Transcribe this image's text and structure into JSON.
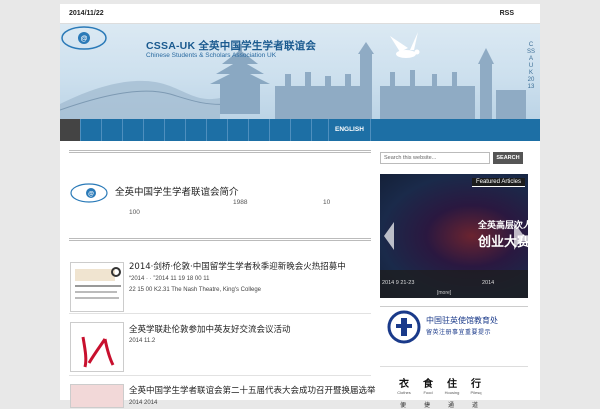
{
  "topbar": {
    "date": "2014/11/22",
    "rss": "RSS"
  },
  "header": {
    "logo_text": "css@uk",
    "title": "CSSA-UK 全英中国学生学者联谊会",
    "subtitle": "Chinese Students & Scholars Association UK",
    "vertical_text": "CSSAUK 2013"
  },
  "nav": {
    "english_label": "ENGLISH"
  },
  "intro": {
    "title": "全英中国学生学者联谊会简介",
    "year": "1988",
    "num1": "10",
    "num2": "100"
  },
  "posts": [
    {
      "title": "2014·剑桥·伦敦·中国留学生学者秋季迎新晚会火热招募中",
      "meta_line1": "“2014      ·      ·      ”2014  11 19 18 00      11",
      "meta_line2": "22 15 00                K2.31 The Nash Theatre, King's College",
      "thumb_label": "2014秋季"
    },
    {
      "title": "全英学联赴伦敦参加中英友好交流会议活动",
      "meta_line1": "2014 11.2"
    },
    {
      "title": "全英中国学生学者联谊会第二十五届代表大会成功召开暨换届选举",
      "meta_line1": "2014            2014"
    }
  ],
  "sidebar": {
    "search_placeholder": "Search this website...",
    "search_button": "SEARCH",
    "featured": {
      "label": "Featured Articles",
      "headline1": "全英高层次人",
      "headline2": "创业大赛",
      "date": "2014 9 21-23",
      "date2": "2014",
      "more": "[more]"
    },
    "embassy": {
      "name": "中国驻英使馆教育处",
      "sub": "留英注册事宜重要提示"
    },
    "services": [
      {
        "big": "衣",
        "small": "Clothes"
      },
      {
        "big": "食",
        "small": "Food"
      },
      {
        "big": "住",
        "small": "Housing"
      },
      {
        "big": "行",
        "small": "Pilesq"
      }
    ],
    "services_low": [
      "便",
      "捷",
      "通",
      "道"
    ]
  },
  "colors": {
    "nav_blue": "#1d6fa5",
    "title_blue": "#1a5a8f",
    "embassy_blue": "#1a3a8a"
  }
}
